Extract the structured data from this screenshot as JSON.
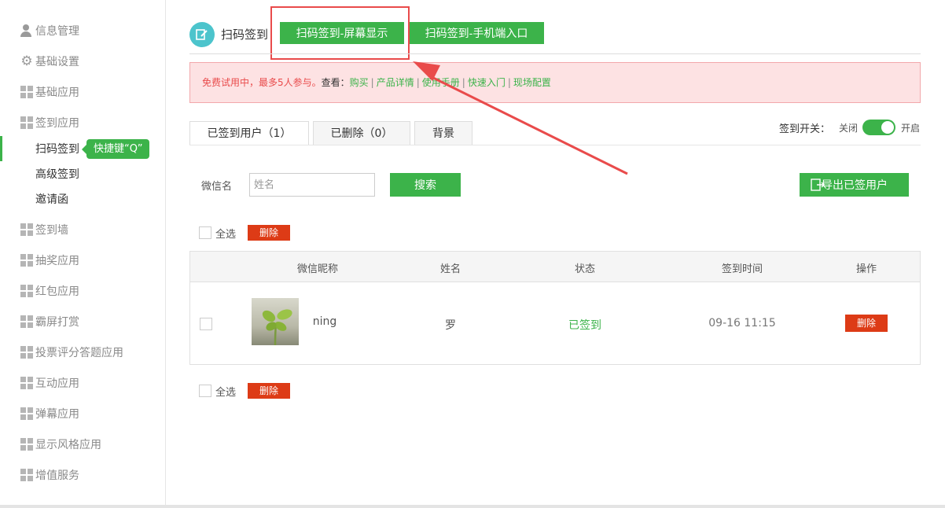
{
  "sidebar": {
    "items": [
      {
        "label": "信息管理",
        "icon": "person-icon"
      },
      {
        "label": "基础设置",
        "icon": "gear-icon"
      },
      {
        "label": "基础应用",
        "icon": "grid-icon"
      },
      {
        "label": "签到应用",
        "icon": "grid-icon"
      },
      {
        "label": "签到墙",
        "icon": "grid-icon"
      },
      {
        "label": "抽奖应用",
        "icon": "grid-icon"
      },
      {
        "label": "红包应用",
        "icon": "grid-icon"
      },
      {
        "label": "霸屏打赏",
        "icon": "grid-icon"
      },
      {
        "label": "投票评分答题应用",
        "icon": "grid-icon"
      },
      {
        "label": "互动应用",
        "icon": "grid-icon"
      },
      {
        "label": "弹幕应用",
        "icon": "grid-icon"
      },
      {
        "label": "显示风格应用",
        "icon": "grid-icon"
      },
      {
        "label": "增值服务",
        "icon": "grid-icon"
      }
    ],
    "sub_items": [
      "扫码签到",
      "高级签到",
      "邀请函"
    ],
    "tip": "快捷键“Q”"
  },
  "header": {
    "title": "扫码签到",
    "btn_screen": "扫码签到-屏幕显示",
    "btn_mobile": "扫码签到-手机端入口"
  },
  "notice": {
    "warning": "免费试用中，最多5人参与。",
    "view": "查看：",
    "links": [
      "购买",
      "产品详情",
      "使用手册",
      "快速入门",
      "现场配置"
    ],
    "separator": "|"
  },
  "tabs": [
    "已签到用户（1）",
    "已删除（0）",
    "背景"
  ],
  "switch": {
    "label": "签到开关：",
    "off": "关闭",
    "on": "开启",
    "state": "on"
  },
  "search": {
    "label": "微信名",
    "placeholder": "姓名",
    "button": "搜索",
    "export": "导出已签用户"
  },
  "bulk": {
    "select_all": "全选",
    "delete": "删除"
  },
  "table": {
    "headers": [
      "微信昵称",
      "姓名",
      "状态",
      "签到时间",
      "操作"
    ],
    "rows": [
      {
        "nickname": "ning",
        "name": "罗",
        "status": "已签到",
        "time": "09-16 11:15",
        "action": "删除"
      }
    ]
  },
  "colors": {
    "accent": "#3cb34a",
    "danger": "#dd3b16",
    "annotation": "#e94b4b"
  }
}
